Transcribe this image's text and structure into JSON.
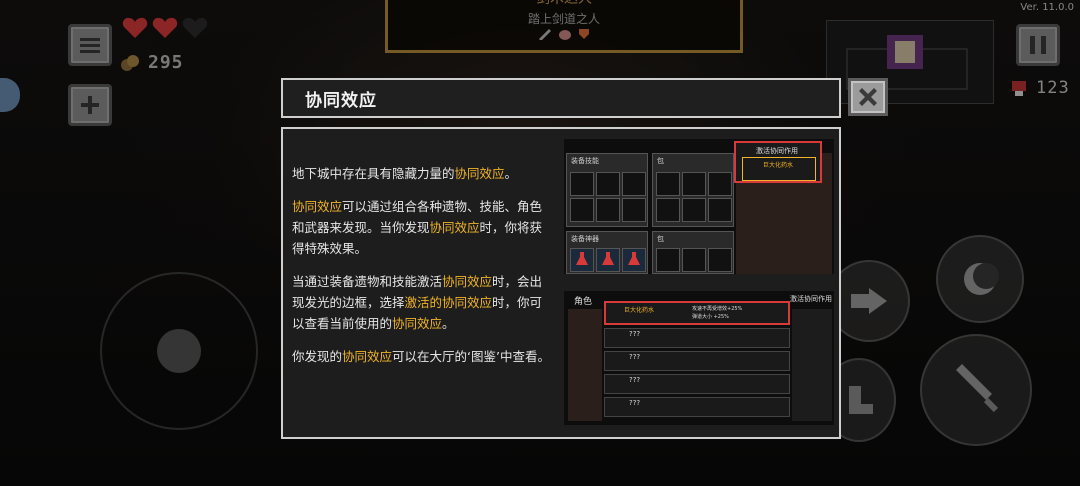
{
  "hud": {
    "coins": "295",
    "score": "123",
    "version": "Ver. 11.0.0",
    "quest_title": "剑术达人",
    "quest_subtitle": "踏上剑道之人",
    "hearts": [
      "full",
      "full",
      "empty"
    ],
    "colors": {
      "heart": "#d83a3a",
      "accent": "#f0b428",
      "panel_border": "#cfcfcf",
      "highlight_box": "#d83a3a"
    }
  },
  "dialog": {
    "title": "协同效应",
    "paragraphs": [
      {
        "a": "地下城中存在具有隐藏力量的",
        "b": "协同效应",
        "c": "。"
      },
      {
        "a": "",
        "b": "协同效应",
        "c": "可以通过组合各种遗物、技能、角色和武器来发现。当你发现",
        "d": "协同效应",
        "e": "时，你将获得特殊效果。"
      },
      {
        "a": "当通过装备遗物和技能激活",
        "b": "协同效应",
        "c": "时，会出现发光的边框，选择",
        "d": "激活的协同效应",
        "e": "时，你可以查看当前使用的",
        "f": "协同效应",
        "g": "。"
      },
      {
        "a": "你发现的",
        "b": "协同效应",
        "c": "可以在大厅的‘图鉴’中查看。"
      }
    ],
    "screenshot_a": {
      "panel_skill": "装备技能",
      "panel_bag_1": "包",
      "panel_weapon": "装备神器",
      "panel_bag_2": "包",
      "active_title": "激活协同作用",
      "active_item": "巨大化药水"
    },
    "screenshot_b": {
      "tab_character": "角色",
      "tab_active": "激活协同作用",
      "row_title": "巨大化药水",
      "row_desc_1": "攻速不再受增效+25%",
      "row_desc_2": "弹道大小 +25%",
      "unknown": [
        "???",
        "???",
        "???",
        "???"
      ]
    }
  },
  "icons": [
    "menu-icon",
    "plus-icon",
    "pause-icon",
    "close-icon",
    "coin-icon",
    "heart-icon",
    "skull-icon",
    "arrow-right-icon",
    "moon-icon",
    "sword-icon",
    "boot-icon",
    "potion-icon"
  ]
}
